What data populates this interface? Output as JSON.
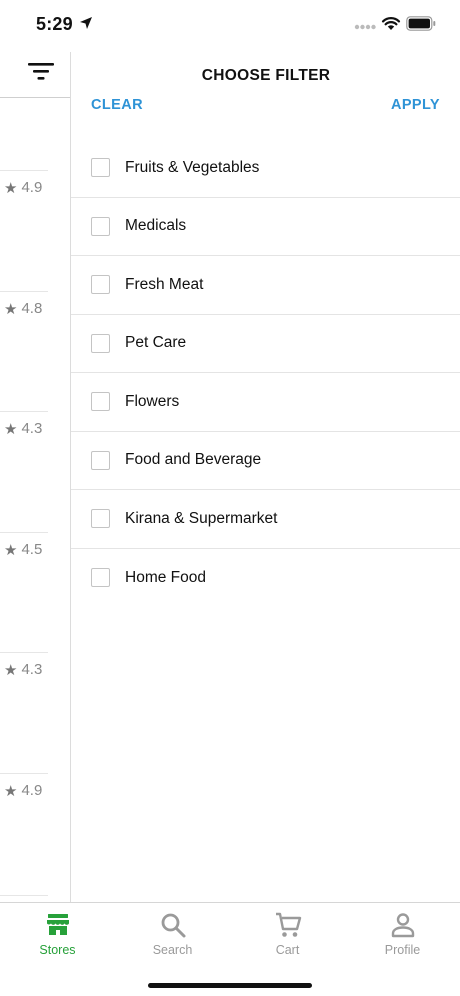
{
  "status_bar": {
    "time": "5:29"
  },
  "store_list": {
    "ratings": [
      "4.9",
      "4.8",
      "4.3",
      "4.5",
      "4.3",
      "4.9"
    ],
    "star_glyph": "★"
  },
  "filter_panel": {
    "title": "CHOOSE FILTER",
    "clear_label": "CLEAR",
    "apply_label": "APPLY",
    "accent_color": "#2e93d6",
    "options": [
      {
        "label": "Fruits & Vegetables",
        "checked": false
      },
      {
        "label": "Medicals",
        "checked": false
      },
      {
        "label": "Fresh Meat",
        "checked": false
      },
      {
        "label": "Pet Care",
        "checked": false
      },
      {
        "label": "Flowers",
        "checked": false
      },
      {
        "label": "Food and Beverage",
        "checked": false
      },
      {
        "label": "Kirana & Supermarket",
        "checked": false
      },
      {
        "label": "Home Food",
        "checked": false
      }
    ]
  },
  "tab_bar": {
    "active_color": "#27a13a",
    "tabs": [
      {
        "label": "Stores",
        "icon": "store-icon",
        "active": true
      },
      {
        "label": "Search",
        "icon": "search-icon",
        "active": false
      },
      {
        "label": "Cart",
        "icon": "cart-icon",
        "active": false
      },
      {
        "label": "Profile",
        "icon": "profile-icon",
        "active": false
      }
    ]
  }
}
